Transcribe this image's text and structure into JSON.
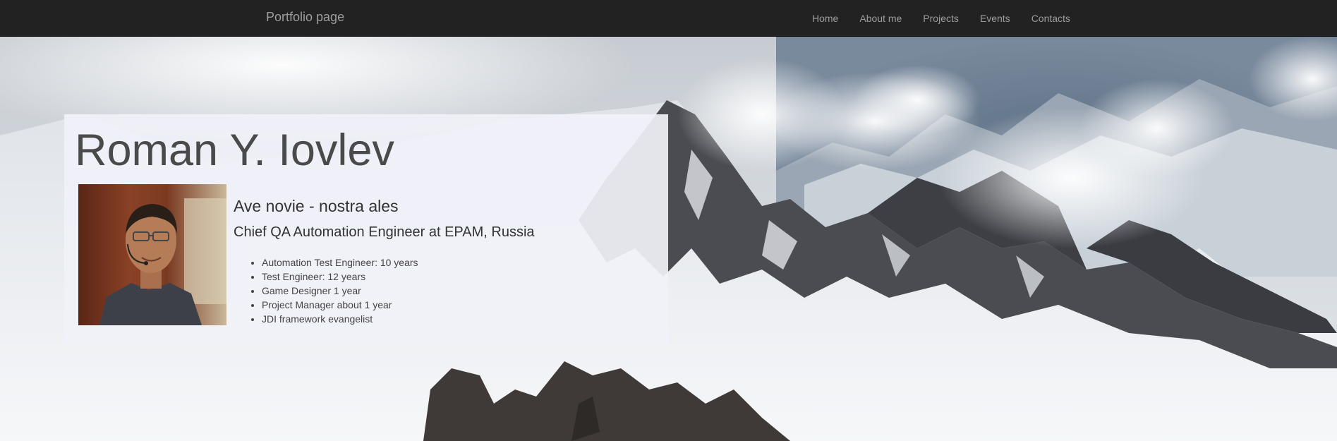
{
  "navbar": {
    "brand": "Portfolio page",
    "items": [
      {
        "label": "Home"
      },
      {
        "label": "About me"
      },
      {
        "label": "Projects"
      },
      {
        "label": "Events"
      },
      {
        "label": "Contacts"
      }
    ]
  },
  "profile": {
    "name": "Roman Y. Iovlev",
    "motto": "Ave novie - nostra ales",
    "position": "Chief QA Automation Engineer at EPAM, Russia",
    "experience": [
      "Automation Test Engineer: 10 years",
      "Test Engineer: 12 years",
      "Game Designer 1 year",
      "Project Manager about 1 year",
      "JDI framework evangelist"
    ]
  },
  "colors": {
    "navbar_bg": "#222222",
    "nav_text": "#9d9d9d",
    "card_bg": "#f1f1f8"
  }
}
